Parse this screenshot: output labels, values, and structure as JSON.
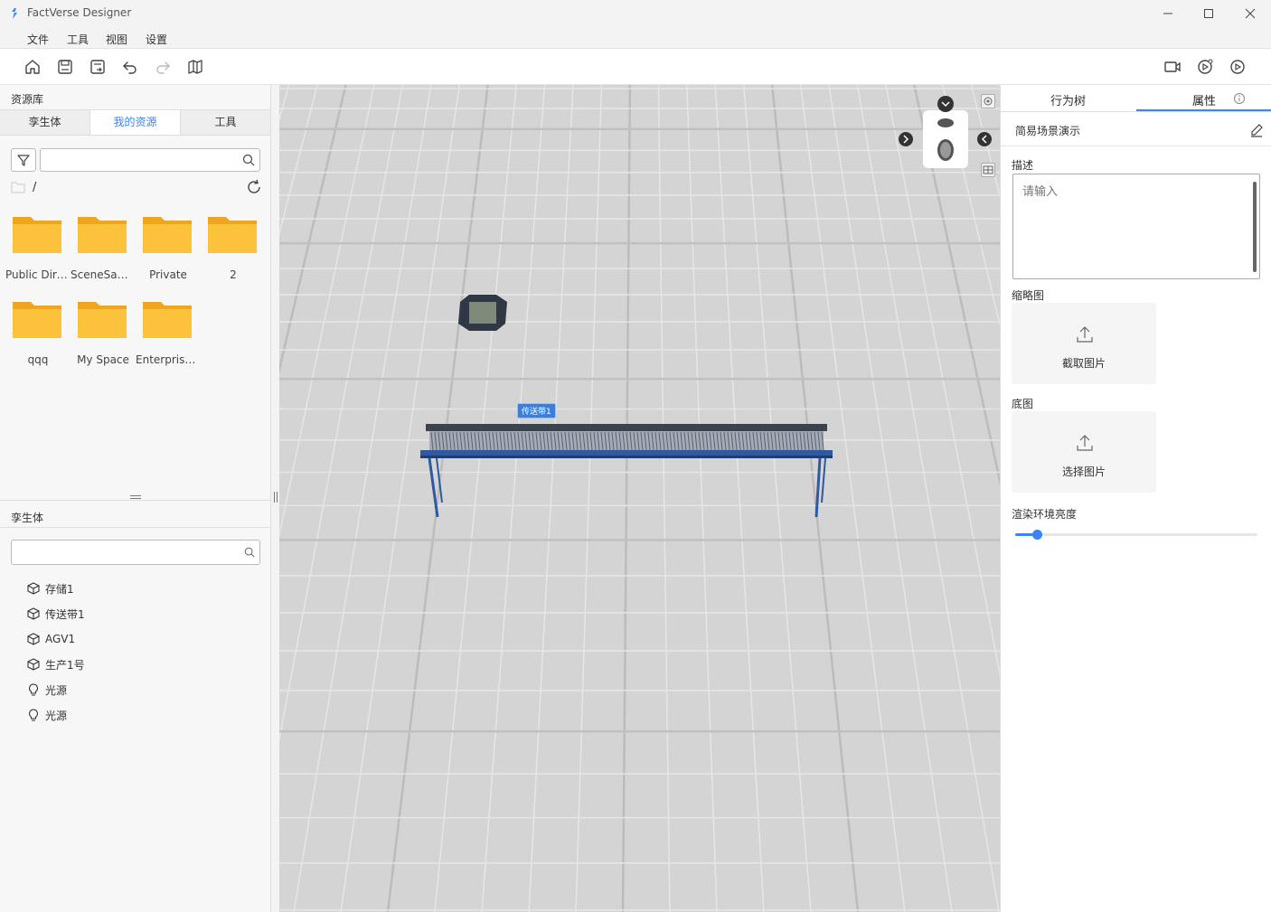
{
  "window": {
    "title": "FactVerse Designer"
  },
  "menu": [
    "文件",
    "工具",
    "视图",
    "设置"
  ],
  "toolbar": {
    "left": [
      "home-icon",
      "save-icon",
      "save-as-icon",
      "undo-icon",
      "redo-icon",
      "map-icon"
    ],
    "right": [
      "camera-icon",
      "publish-icon",
      "play-icon"
    ]
  },
  "left_panel": {
    "title": "资源库",
    "tabs": [
      "孪生体",
      "我的资源",
      "工具"
    ],
    "active_tab": 1,
    "search": {
      "value": "",
      "placeholder": ""
    },
    "path": "/",
    "folders": [
      "Public Directory",
      "SceneSample",
      "Private",
      "2",
      "qqq",
      "My Space",
      "Enterprise space"
    ],
    "twins_title": "孪生体",
    "twins_search": {
      "value": "",
      "placeholder": ""
    },
    "twins": [
      {
        "label": "存储1",
        "icon": "cube-icon"
      },
      {
        "label": "传送带1",
        "icon": "cube-icon"
      },
      {
        "label": "AGV1",
        "icon": "cube-icon"
      },
      {
        "label": "生产1号",
        "icon": "cube-icon"
      },
      {
        "label": "光源",
        "icon": "bulb-icon"
      },
      {
        "label": "光源",
        "icon": "bulb-icon"
      }
    ]
  },
  "viewport": {
    "selected_label": "传送带1"
  },
  "right_panel": {
    "tabs": [
      "行为树",
      "属性"
    ],
    "active_tab": 1,
    "scene_name": "简易场景演示",
    "desc_label": "描述",
    "desc_placeholder": "请输入",
    "thumbnail_label": "缩略图",
    "thumbnail_button": "截取图片",
    "base_label": "底图",
    "base_button": "选择图片",
    "brightness_label": "渲染环境亮度",
    "brightness_value": 0.09,
    "accent": "#3b82f6"
  }
}
